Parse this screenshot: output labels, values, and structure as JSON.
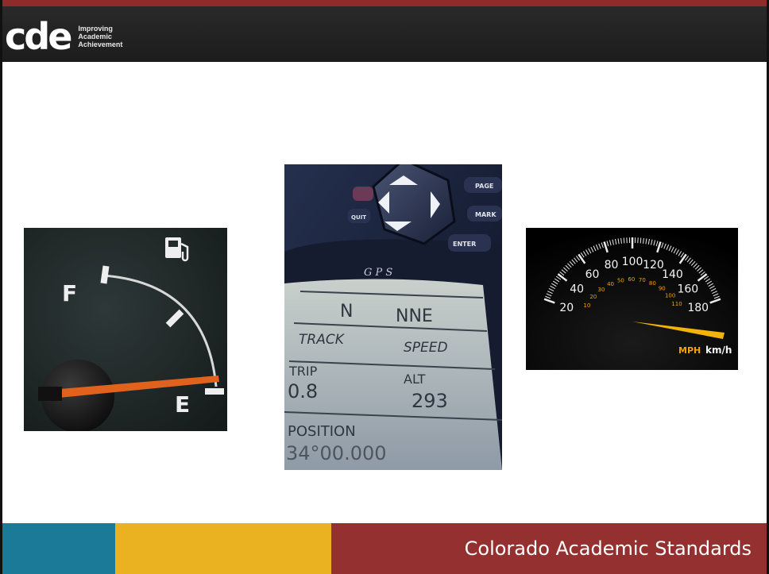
{
  "header": {
    "logo_mark": "cde",
    "logo_tagline": [
      "Improving",
      "Academic",
      "Achievement"
    ]
  },
  "images": {
    "fuel_gauge": {
      "labels": {
        "full": "F",
        "empty": "E"
      },
      "icon": "fuel-pump-icon"
    },
    "gps": {
      "labels": {
        "title": "G P S",
        "north": "N",
        "nne": "NNE",
        "track": "TRACK",
        "speed": "SPEED",
        "trip": "TRIP",
        "alt": "ALT",
        "trip_val": "0.8",
        "alt_val": "293",
        "position": "POSITION",
        "pos_val": "34°00.000",
        "quit": "QUIT",
        "page": "PAGE",
        "mark": "MARK",
        "enter": "ENTER"
      }
    },
    "speedometer": {
      "mph_labels": [
        "20",
        "40",
        "60",
        "80",
        "100",
        "120",
        "140",
        "160",
        "180"
      ],
      "kmh_labels": [
        "10",
        "20",
        "30",
        "40",
        "50",
        "60",
        "70",
        "80",
        "90",
        "100",
        "110"
      ],
      "unit_mph": "MPH",
      "unit_kmh": "km/h"
    }
  },
  "footer": {
    "title": "Colorado Academic Standards",
    "colors": {
      "teal": "#1c7a99",
      "gold": "#eab121",
      "red": "#943030"
    }
  }
}
